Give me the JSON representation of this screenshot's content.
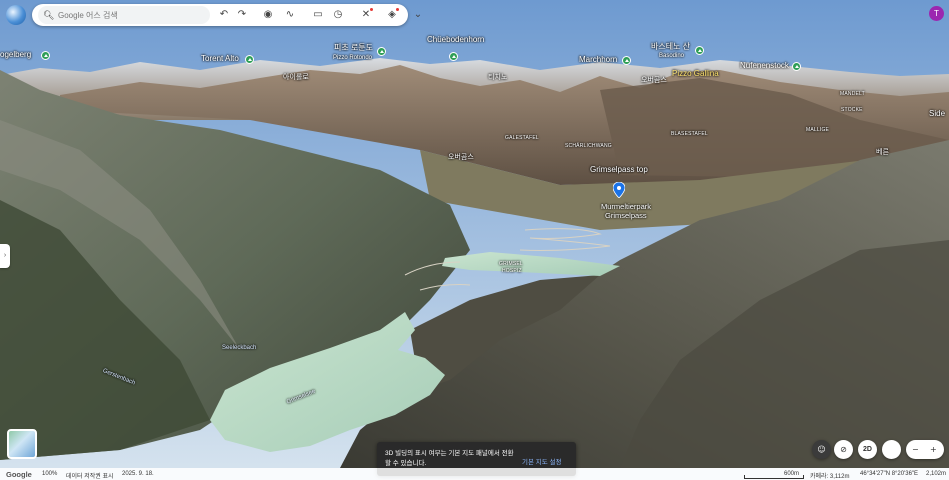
{
  "search": {
    "placeholder": "Google 어스 검색"
  },
  "account": {
    "initial": "T"
  },
  "toolbar": {
    "icons": [
      "search-icon",
      "undo-icon",
      "redo-icon",
      "pin-icon",
      "path-icon",
      "ruler-icon",
      "history-icon",
      "projects-icon",
      "layers-icon",
      "chevron-down-icon"
    ]
  },
  "map": {
    "peaks": [
      {
        "name": "ogelberg"
      },
      {
        "name": "Torent Alto"
      },
      {
        "name": "피초 로툰도"
      },
      {
        "name": "Pizzo Rotondo"
      },
      {
        "name": "Chüebodenhorn"
      },
      {
        "name": "Marchhorn"
      },
      {
        "name": "바스테노 산"
      },
      {
        "name": "Basodino"
      },
      {
        "name": "Pizzo Gallina"
      },
      {
        "name": "Nufenenstock"
      }
    ],
    "places": {
      "airolo": "아이롤로",
      "ticino": "티치노",
      "obergoms": "오버곰스",
      "galestafel": "GALESTAFEL",
      "scharlichwang": "SCHÄRLICHWANG",
      "blasestafel": "BLASESTAFEL",
      "mandelt": "MANDELT",
      "stocke": "STOCKE",
      "mallige": "MALLIGE",
      "side": "Side",
      "obergoms2": "오버곰스",
      "bern": "베른",
      "hospiz1": "GRIMSEL",
      "hospiz2": "HOSPIZ",
      "seeleckbach": "Seeleckbach",
      "gerstenbach": "Gerstenbach",
      "lake": "Grimselsee"
    },
    "pin": {
      "label_top": "Grimselpass top",
      "label1": "Murmeltierpark",
      "label2": "Grimselpass"
    }
  },
  "toast": {
    "message": "3D 빌딩의 표시 여부는 기본 지도 패널에서 전환할 수 있습니다.",
    "action": "기본 지도 설정"
  },
  "controls": {
    "mode_2d": "2D",
    "zoom_out": "−",
    "zoom_in": "+"
  },
  "status": {
    "logo": "Google",
    "zoom": "100%",
    "attribution": "데이터 저작권 표시",
    "date": "2025. 9. 18.",
    "scale": "600m",
    "camera": "카메라: 3,112m",
    "coords": "46°34'27\"N 8°20'36\"E",
    "altitude": "2,102m"
  },
  "colors": {
    "peak_pin": "#2f9e57",
    "location_pin": "#1a73e8",
    "avatar": "#9c27b0",
    "toast_action": "#8ab4f8",
    "lake": "#b8d8c4"
  }
}
